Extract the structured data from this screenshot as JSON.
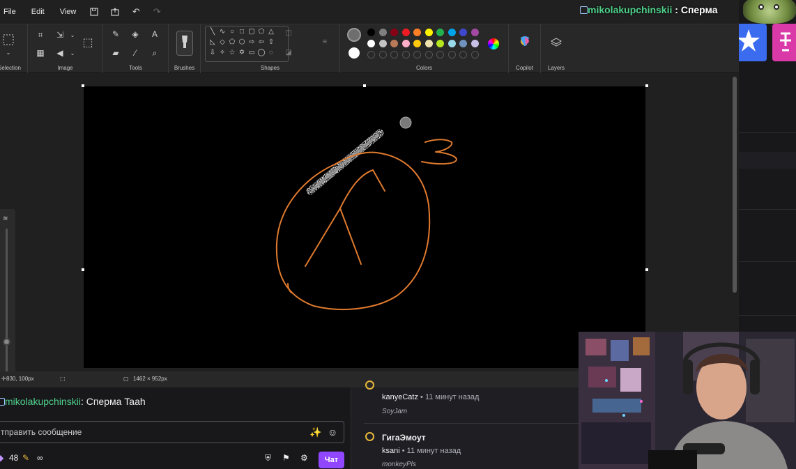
{
  "menu": {
    "file": "File",
    "edit": "Edit",
    "view": "View"
  },
  "ribbon": {
    "groups": {
      "selection": "Selection",
      "image": "Image",
      "tools": "Tools",
      "brushes": "Brushes",
      "shapes": "Shapes",
      "colors": "Colors",
      "copilot": "Copilot",
      "layers": "Layers"
    },
    "palette_row1": [
      "#000000",
      "#7f7f7f",
      "#880015",
      "#ed1c24",
      "#ff7f27",
      "#fff200",
      "#22b14c",
      "#00a2e8",
      "#3f48cc",
      "#a349a4"
    ],
    "palette_row2": [
      "#ffffff",
      "#c3c3c3",
      "#b97a57",
      "#ffaec9",
      "#ffc90e",
      "#efe4b0",
      "#b5e61d",
      "#99d9ea",
      "#7092be",
      "#c8bfe7"
    ],
    "primary_color": "#6e6e6e",
    "secondary_color": "#ffffff",
    "stroke_color": "#e07a2e"
  },
  "status": {
    "cursor": "830, 100px",
    "size": "1462 × 952px"
  },
  "overlay": {
    "user": "mikolakupchinskii",
    "sep": " : ",
    "message": "Сперма"
  },
  "chat": {
    "user": "mikolakupchinskii",
    "message": ": Сперма Taah",
    "placeholder": "тправить сообщение",
    "points": "48",
    "infinity": "∞",
    "send_label": "Чат"
  },
  "feed": [
    {
      "user": "kanyeCatz",
      "time": " • 11 минут назад",
      "emote": "SoyJam"
    },
    {
      "title": "ГигаЭмоут",
      "user": "ksani",
      "time": " • 11 минут назад",
      "emote": "monkeyPls"
    }
  ]
}
